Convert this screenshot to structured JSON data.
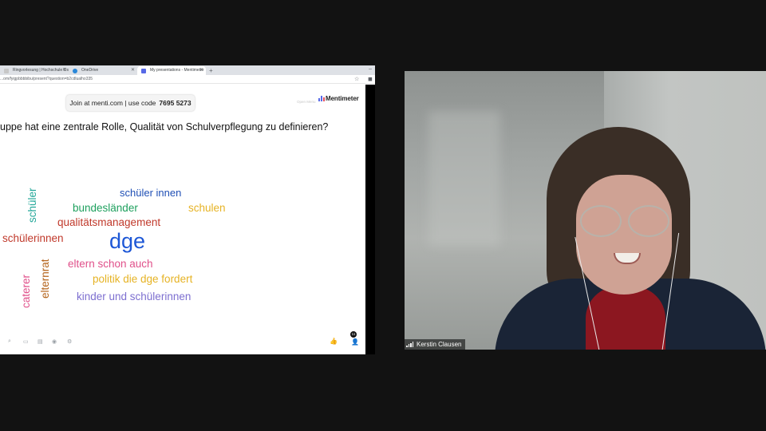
{
  "browser": {
    "tabs": [
      {
        "label": "Ringvorlesung | Hochschule Os",
        "icon": "page-icon",
        "active": false
      },
      {
        "label": "OneDrive",
        "icon": "cloud-icon",
        "active": false
      },
      {
        "label": "My presentations - Mentimeter",
        "icon": "mentimeter-icon",
        "active": true
      }
    ],
    "new_tab": "+",
    "url": "...om/fyigpbbbbibu/present?question=b2cdlualho335"
  },
  "menti": {
    "join_text": "Join at menti.com | use code",
    "join_code": "7695 5273",
    "open_menu": "Open Menu",
    "brand": "Mentimeter",
    "question": "uppe hat eine zentrale Rolle, Qualität von Schulverpflegung zu definieren?",
    "words": [
      {
        "text": "schüler innen",
        "color": "#1f4fb5"
      },
      {
        "text": "bundesländer",
        "color": "#1ea05e"
      },
      {
        "text": "schulen",
        "color": "#e6b325"
      },
      {
        "text": "qualitätsmanagement",
        "color": "#c0392b"
      },
      {
        "text": "schülerinnen",
        "color": "#c0392b"
      },
      {
        "text": "dge",
        "color": "#1d57d6"
      },
      {
        "text": "eltern schon auch",
        "color": "#e0508a"
      },
      {
        "text": "politik die dge fordert",
        "color": "#e6b325"
      },
      {
        "text": "kinder und schülerinnen",
        "color": "#7d6fd0"
      },
      {
        "text": "schüler",
        "color": "#25a89a"
      },
      {
        "text": "elternrat",
        "color": "#b5651d"
      },
      {
        "text": "caterer",
        "color": "#e0508a"
      }
    ],
    "participant_count": "11"
  },
  "video": {
    "participant_name": "Kerstin Clausen"
  }
}
